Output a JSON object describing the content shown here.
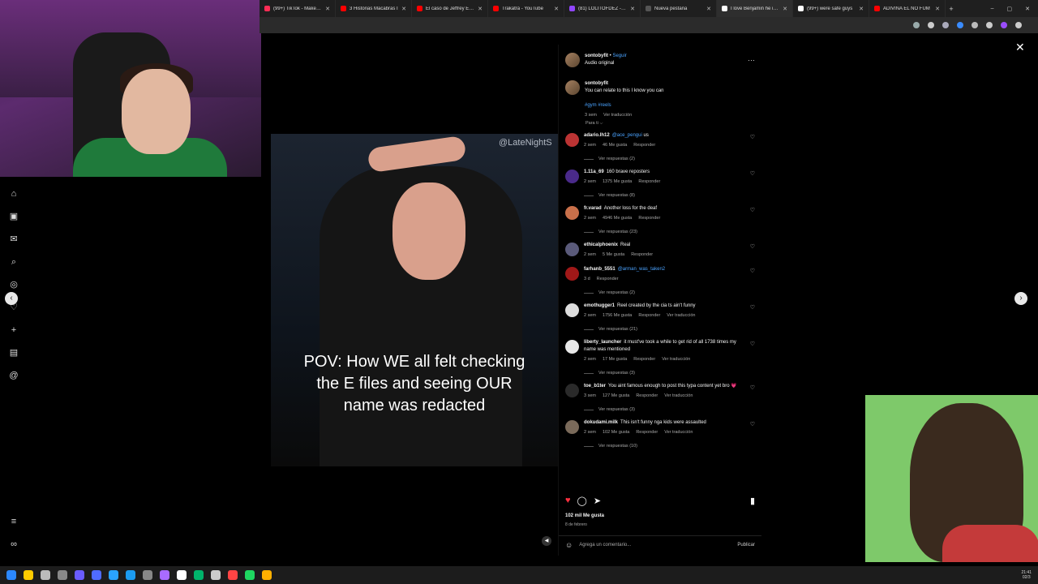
{
  "browser": {
    "tabs": [
      {
        "title": "(99+) TikTok - Make Yo",
        "color": "#ff2d55"
      },
      {
        "title": "3 Historias Macabras I",
        "color": "#ff0000"
      },
      {
        "title": "El caso de Jeffrey Epst",
        "color": "#ff0000"
      },
      {
        "title": "Trakatrá - YouTube",
        "color": "#ff0000"
      },
      {
        "title": "(81) LOLITOFDEZ - Twi",
        "color": "#9146ff"
      },
      {
        "title": "Nueva pestaña",
        "color": "#555555"
      },
      {
        "title": "I love Benjamin he is a",
        "color": "#ffffff"
      },
      {
        "title": "(99+) were safe guys",
        "color": "#ffffff"
      },
      {
        "title": "ADIVINA EL NO FUM",
        "color": "#ff0000"
      }
    ],
    "newtab_icon": "+",
    "window_controls": [
      "–",
      "▢",
      "✕"
    ]
  },
  "nav": {
    "close_icon": "✕",
    "prev_icon": "‹",
    "next_icon": "›"
  },
  "reel": {
    "watermark": "@LateNightS",
    "caption": "POV: How WE all felt checking the E files and seeing OUR name was redacted"
  },
  "post": {
    "username": "sontobyfit",
    "separator": "•",
    "follow_label": "Seguir",
    "audio": "Audio original",
    "more_icon": "···",
    "caption_text": "You can relate to this I know you can",
    "hashtags": "#gym #reels",
    "caption_time": "3 sem",
    "caption_translate": "Ver traducción",
    "sort_label": "Para ti ⌵",
    "likes": "102 mil Me gusta",
    "date": "8 de febrero",
    "comment_placeholder": "Agrega un comentario...",
    "publish_label": "Publicar"
  },
  "comments": [
    {
      "user": "adario.lh12",
      "mention": "@ace_pengui",
      "text": "us",
      "time": "2 sem",
      "likes": "46 Me gusta",
      "reply": "Responder",
      "translate": "",
      "replies": "Ver respuestas (2)",
      "color": "#b33"
    },
    {
      "user": "1.11a_69",
      "mention": "",
      "text": "160 brave reposters",
      "time": "2 sem",
      "likes": "1375 Me gusta",
      "reply": "Responder",
      "translate": "",
      "replies": "Ver respuestas (8)",
      "color": "#4a2a8a"
    },
    {
      "user": "fr.varad",
      "mention": "",
      "text": "Another loss for the deaf",
      "time": "2 sem",
      "likes": "4946 Me gusta",
      "reply": "Responder",
      "translate": "",
      "replies": "Ver respuestas (23)",
      "color": "#c9704a"
    },
    {
      "user": "ethicalphoenix",
      "mention": "",
      "text": "Real",
      "time": "2 sem",
      "likes": "5 Me gusta",
      "reply": "Responder",
      "translate": "",
      "replies": "",
      "color": "#5a5a7a"
    },
    {
      "user": "farhanb_5551",
      "mention": "@arman_was_taken2",
      "text": "",
      "time": "3 d",
      "likes": "",
      "reply": "Responder",
      "translate": "",
      "replies": "Ver respuestas (2)",
      "color": "#a01818"
    },
    {
      "user": "emothugger1",
      "mention": "",
      "text": "Reel created by the cia ts ain't funny",
      "time": "2 sem",
      "likes": "1756 Me gusta",
      "reply": "Responder",
      "translate": "Ver traducción",
      "replies": "Ver respuestas (21)",
      "color": "#ddd"
    },
    {
      "user": "liberty_launcher",
      "mention": "",
      "text": "it must've took a while to get rid of all 1738 times my name was mentioned",
      "time": "2 sem",
      "likes": "17 Me gusta",
      "reply": "Responder",
      "translate": "Ver traducción",
      "replies": "Ver respuestas (3)",
      "color": "#e8e8e8"
    },
    {
      "user": "toe_b1ter",
      "mention": "",
      "text": "You aint famous enough to post this typa content yet bro 💗",
      "time": "3 sem",
      "likes": "127 Me gusta",
      "reply": "Responder",
      "translate": "Ver traducción",
      "replies": "Ver respuestas (3)",
      "color": "#2a2a2a"
    },
    {
      "user": "dokudami.milk",
      "mention": "",
      "text": "This isn't funny nga kids were assaulted",
      "time": "2 sem",
      "likes": "102 Me gusta",
      "reply": "Responder",
      "translate": "Ver traducción",
      "replies": "Ver respuestas (10)",
      "color": "#7a6a5a"
    }
  ],
  "actions": {
    "like_icon": "♥",
    "comment_icon": "◯",
    "share_icon": "➤",
    "save_icon": "▮",
    "heart_small_icon": "♡",
    "emoji_icon": "☺",
    "like_color": "#ff3040"
  },
  "taskbar": {
    "time": "21:41",
    "date": "02/3",
    "icon_colors": [
      "#2b88ff",
      "#ffcc00",
      "#bbbbbb",
      "#888888",
      "#6a5cff",
      "#4f6bff",
      "#2aa3ff",
      "#1b9bf0",
      "#888888",
      "#a86bff",
      "#ffffff",
      "#00b36b",
      "#cccccc",
      "#ff4444",
      "#1ed760",
      "#ffb000"
    ]
  }
}
